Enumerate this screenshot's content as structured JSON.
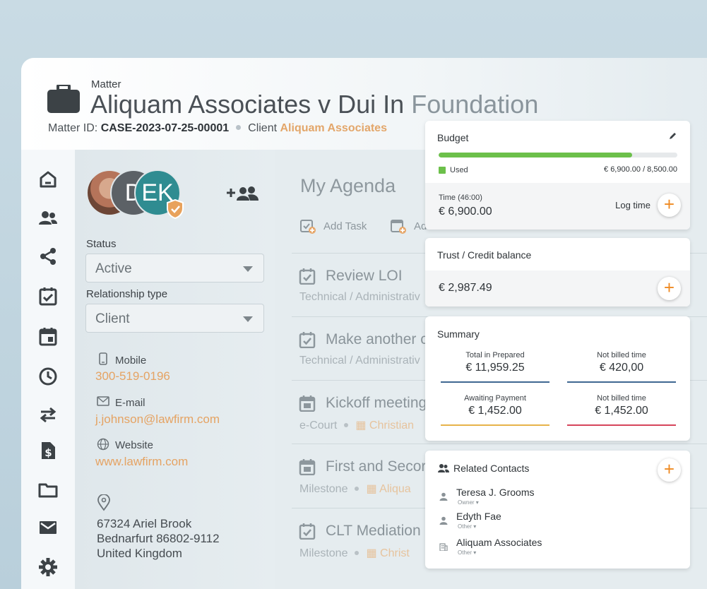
{
  "header": {
    "matter_label": "Matter",
    "title_main": "Aliquam Associates v Dui In ",
    "title_fade": "Foundation",
    "matter_id_label": "Matter ID: ",
    "matter_id": "CASE-2023-07-25-00001",
    "client_label": "Client",
    "client_value": "Aliquam Associates"
  },
  "nav": {
    "icons": [
      "home-icon",
      "people-icon",
      "share-icon",
      "task-check-icon",
      "calendar-icon",
      "clock-icon",
      "transfer-icon",
      "invoice-dollar-icon",
      "folder-icon",
      "mail-icon",
      "gear-icon"
    ]
  },
  "contact_panel": {
    "avatars": [
      "D",
      "EK"
    ],
    "status_label": "Status",
    "status_value": "Active",
    "relationship_label": "Relationship type",
    "relationship_value": "Client",
    "mobile_label": "Mobile",
    "mobile_value": "300-519-0196",
    "email_label": "E-mail",
    "email_value": "j.johnson@lawfirm.com",
    "website_label": "Website",
    "website_value": "www.lawfirm.com",
    "address_line1": "67324 Ariel Brook",
    "address_line2": "Bednarfurt 86802-9112",
    "address_line3": "United Kingdom"
  },
  "agenda": {
    "title": "My Agenda",
    "add_task": "Add Task",
    "add_event": "Ad",
    "tasks": [
      {
        "title": "Review LOI",
        "sub": "Technical / Administrativ",
        "icon": "check"
      },
      {
        "title": "Make another c",
        "sub": "Technical / Administrativ",
        "icon": "check"
      },
      {
        "title": "Kickoff meeting",
        "sub1": "e-Court",
        "sub2": "Christian",
        "icon": "calendar"
      },
      {
        "title": "First and Secor",
        "sub1": "Milestone",
        "sub2": "Aliqua",
        "icon": "calendar"
      },
      {
        "title": "CLT Mediation",
        "sub1": "Milestone",
        "sub2": "Christ",
        "icon": "check"
      }
    ]
  },
  "budget": {
    "title": "Budget",
    "used_label": "Used",
    "used_amount": "€ 6,900.00 / 8,500.00",
    "used_fraction": 0.81,
    "time_label": "Time (46:00)",
    "time_value": "€ 6,900.00",
    "log_time": "Log time"
  },
  "trust": {
    "title": "Trust / Credit balance",
    "value": "€ 2,987.49"
  },
  "summary": {
    "title": "Summary",
    "cells": [
      {
        "label": "Total in Prepared",
        "value": "€ 11,959.25",
        "color": "#3f6791"
      },
      {
        "label": "Not billed time",
        "value": "€ 420,00",
        "color": "#3f6791"
      },
      {
        "label": "Awaiting Payment",
        "value": "€ 1,452.00",
        "color": "#e7b34a"
      },
      {
        "label": "Not billed time",
        "value": "€ 1,452.00",
        "color": "#d6455b"
      }
    ]
  },
  "related": {
    "title": "Related Contacts",
    "contacts": [
      {
        "name": "Teresa J. Grooms",
        "role": "Owner"
      },
      {
        "name": "Edyth Fae",
        "role": "Other"
      },
      {
        "name": "Aliquam Associates",
        "role": "Other"
      }
    ]
  },
  "colors": {
    "accent": "#ef8a22",
    "link": "#e5a363",
    "progress": "#6cc04a",
    "teal": "#2f8c91"
  }
}
